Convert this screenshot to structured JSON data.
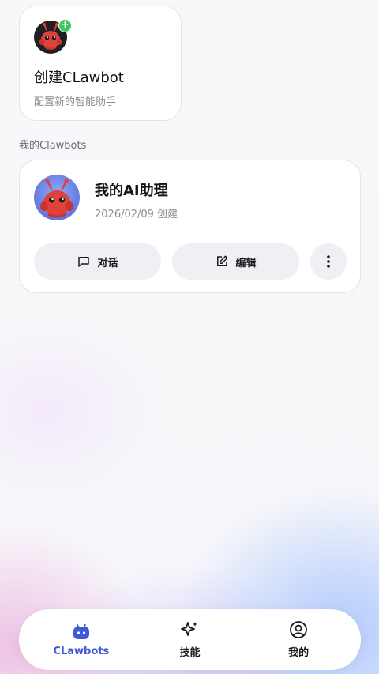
{
  "create_card": {
    "title": "创建CLawbot",
    "subtitle": "配置新的智能助手",
    "badge": "+"
  },
  "section_label": "我的Clawbots",
  "bot": {
    "name": "我的AI助理",
    "created": "2026/02/09 创建",
    "chat_label": "对话",
    "edit_label": "编辑"
  },
  "tabs": [
    {
      "label": "CLawbots",
      "icon": "android-icon",
      "active": true
    },
    {
      "label": "技能",
      "icon": "sparkle-icon",
      "active": false
    },
    {
      "label": "我的",
      "icon": "user-circle-icon",
      "active": false
    }
  ],
  "colors": {
    "accent": "#3f57d8",
    "badge_green": "#3fc55f",
    "mascot_red": "#e0413a",
    "pill_bg": "#efeff4"
  }
}
